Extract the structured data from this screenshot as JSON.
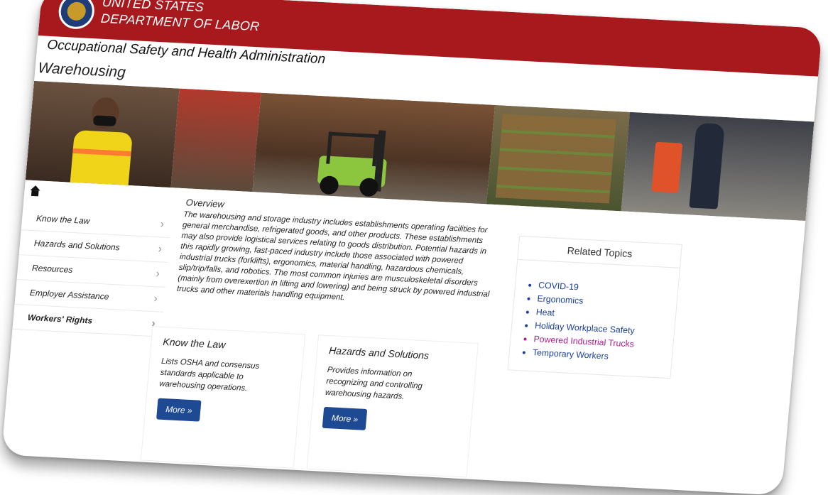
{
  "header": {
    "dol_line1": "UNITED STATES",
    "dol_line2": "DEPARTMENT OF LABOR",
    "agency": "Occupational Safety and Health Administration",
    "page_title": "Warehousing",
    "colors": {
      "banner": "#a8191e"
    }
  },
  "hero": {
    "icons": [
      "worker-photo",
      "forklift-photo",
      "produce-crates-photo"
    ]
  },
  "nav": {
    "home_icon": "home-icon",
    "items": [
      {
        "label": "Know the Law"
      },
      {
        "label": "Hazards and Solutions"
      },
      {
        "label": "Resources"
      },
      {
        "label": "Employer Assistance"
      },
      {
        "label": "Workers' Rights"
      }
    ],
    "chevron": "›"
  },
  "overview": {
    "title": "Overview",
    "text": "The warehousing and storage industry includes establishments operating facilities for general merchandise, refrigerated goods, and other products. These establishments may also provide logistical services relating to goods distribution. Potential hazards in this rapidly growing, fast-paced industry include those associated with powered industrial trucks (forklifts), ergonomics, material handling, hazardous chemicals, slip/trip/falls, and robotics. The most common injuries are musculoskeletal disorders (mainly from overexertion in lifting and lowering) and being struck by powered industrial trucks and other materials handling equipment."
  },
  "related": {
    "title": "Related Topics",
    "items": [
      {
        "label": "COVID-19"
      },
      {
        "label": "Ergonomics"
      },
      {
        "label": "Heat"
      },
      {
        "label": "Holiday Workplace Safety"
      },
      {
        "label": "Powered Industrial Trucks",
        "visited": true
      },
      {
        "label": "Temporary Workers"
      }
    ],
    "colors": {
      "link": "#1b3f9c",
      "visited": "#b01a8f"
    }
  },
  "boxes": [
    {
      "title": "Know the Law",
      "text": "Lists OSHA and consensus standards applicable to warehousing operations.",
      "button": "More »"
    },
    {
      "title": "Hazards and Solutions",
      "text": "Provides information on recognizing and controlling warehousing hazards.",
      "button": "More »"
    }
  ]
}
